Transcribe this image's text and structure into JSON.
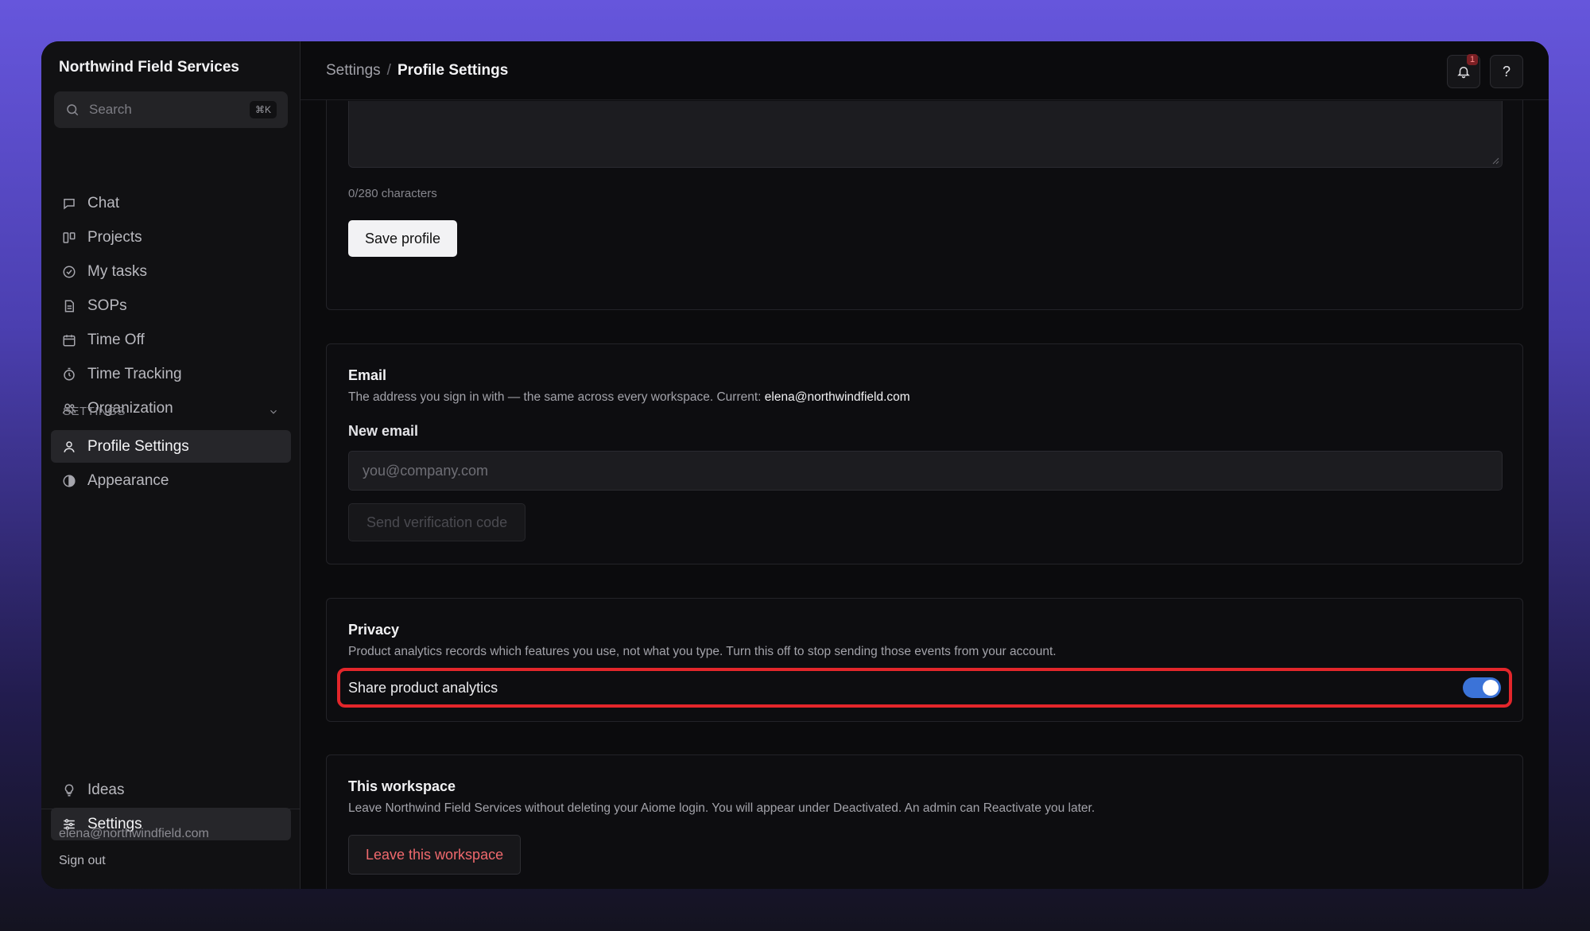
{
  "app": {
    "org_name": "Northwind Field Services"
  },
  "search": {
    "placeholder": "Search",
    "shortcut": "⌘K"
  },
  "sidebar": {
    "items": [
      {
        "label": "Chat",
        "icon": "chat-icon"
      },
      {
        "label": "Projects",
        "icon": "projects-icon"
      },
      {
        "label": "My tasks",
        "icon": "check-circle-icon"
      },
      {
        "label": "SOPs",
        "icon": "document-icon"
      },
      {
        "label": "Time Off",
        "icon": "calendar-icon"
      },
      {
        "label": "Time Tracking",
        "icon": "stopwatch-icon"
      },
      {
        "label": "Organization",
        "icon": "users-icon"
      }
    ],
    "settings_section": "SETTINGS",
    "settings_items": [
      {
        "label": "Profile Settings",
        "icon": "user-icon",
        "active": true
      },
      {
        "label": "Appearance",
        "icon": "contrast-icon",
        "active": false
      }
    ],
    "bottom_items": [
      {
        "label": "Ideas",
        "icon": "lightbulb-icon",
        "active": false
      },
      {
        "label": "Settings",
        "icon": "sliders-icon",
        "active": true
      }
    ],
    "user_email": "elena@northwindfield.com",
    "sign_out": "Sign out"
  },
  "breadcrumb": {
    "parent": "Settings",
    "separator": "/",
    "current": "Profile Settings"
  },
  "topbar": {
    "notification_count": "1",
    "help_label": "?"
  },
  "profile": {
    "char_count": "0/280 characters",
    "save_label": "Save profile"
  },
  "email": {
    "title": "Email",
    "description": "The address you sign in with — the same across every workspace. Current:",
    "current": "elena@northwindfield.com",
    "new_label": "New email",
    "placeholder": "you@company.com",
    "send_label": "Send verification code"
  },
  "privacy": {
    "title": "Privacy",
    "description": "Product analytics records which features you use, not what you type. Turn this off to stop sending those events from your account.",
    "toggle_label": "Share product analytics",
    "toggle_on": true
  },
  "workspace": {
    "title": "This workspace",
    "description": "Leave Northwind Field Services without deleting your Aiome login. You will appear under Deactivated. An admin can Reactivate you later.",
    "leave_label": "Leave this workspace"
  },
  "colors": {
    "accent": "#3b73d8",
    "danger": "#f0696d",
    "highlight": "#e3262b",
    "background_top": "#6656dc"
  }
}
